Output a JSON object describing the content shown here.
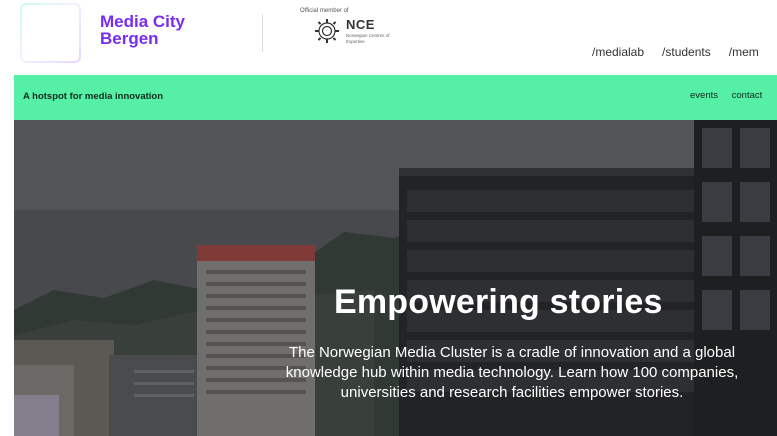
{
  "brand": {
    "name_line1": "Media City",
    "name_line2": "Bergen",
    "accent": "#7a2cf0"
  },
  "partner": {
    "caption": "Official member of",
    "abbrev": "NCE",
    "subtitle": "Norwegian Centres of Expertise"
  },
  "top_nav": [
    "/medialab",
    "/students",
    "/mem"
  ],
  "green_bar": {
    "tagline": "A hotspot for media innovation",
    "links": [
      "events",
      "contact"
    ],
    "color": "#55f0a6"
  },
  "hero": {
    "title": "Empowering stories",
    "text": "The Norwegian Media Cluster is a cradle of innovation and a global knowledge hub within media technology. Learn how 100 companies, universities and research facilities empower stories."
  }
}
